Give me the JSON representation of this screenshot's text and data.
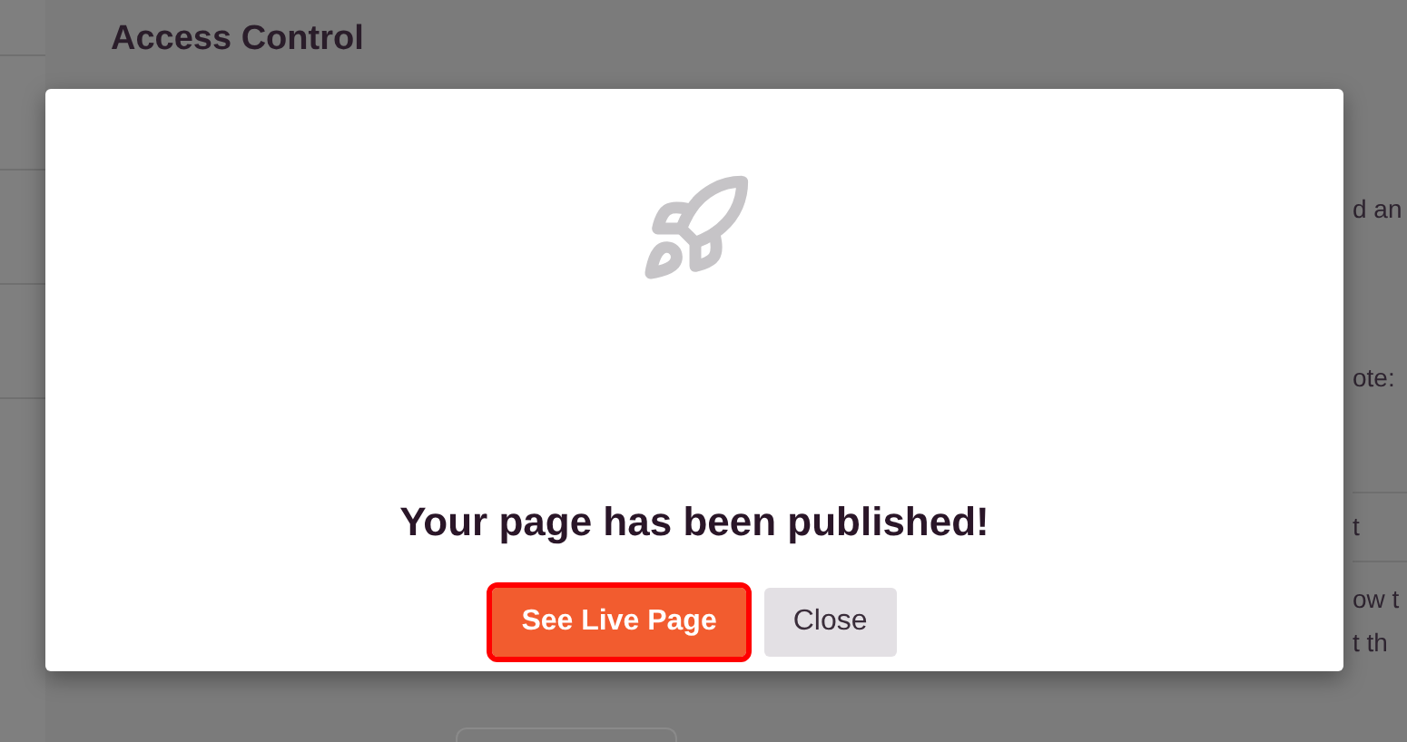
{
  "page": {
    "heading": "Access Control",
    "fragments": [
      "d an",
      "ote:",
      "t",
      "ow t",
      "t th"
    ]
  },
  "modal": {
    "message": "Your page has been published!",
    "buttons": [
      {
        "label": "See Live Page",
        "kind": "primary",
        "focused": true
      },
      {
        "label": "Close",
        "kind": "secondary",
        "focused": false
      }
    ]
  }
}
